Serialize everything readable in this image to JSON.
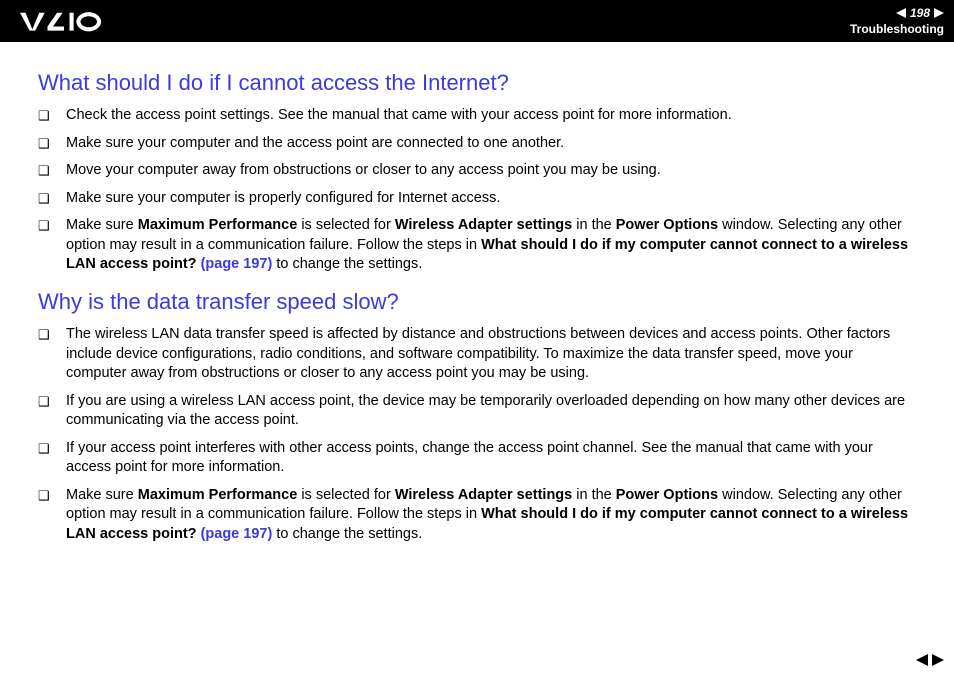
{
  "header": {
    "page_number": "198",
    "section": "Troubleshooting"
  },
  "sections": [
    {
      "heading": "What should I do if I cannot access the Internet?",
      "items": [
        {
          "runs": [
            {
              "t": "Check the access point settings. See the manual that came with your access point for more information."
            }
          ]
        },
        {
          "runs": [
            {
              "t": "Make sure your computer and the access point are connected to one another."
            }
          ]
        },
        {
          "runs": [
            {
              "t": "Move your computer away from obstructions or closer to any access point you may be using."
            }
          ]
        },
        {
          "runs": [
            {
              "t": "Make sure your computer is properly configured for Internet access."
            }
          ]
        },
        {
          "runs": [
            {
              "t": "Make sure "
            },
            {
              "t": "Maximum Performance",
              "b": true
            },
            {
              "t": " is selected for "
            },
            {
              "t": "Wireless Adapter settings",
              "b": true
            },
            {
              "t": " in the "
            },
            {
              "t": "Power Options",
              "b": true
            },
            {
              "t": " window. Selecting any other option may result in a communication failure. Follow the steps in "
            },
            {
              "t": "What should I do if my computer cannot connect to a wireless LAN access point? ",
              "b": true
            },
            {
              "t": "(page 197)",
              "link": true
            },
            {
              "t": " to change the settings."
            }
          ]
        }
      ]
    },
    {
      "heading": "Why is the data transfer speed slow?",
      "items": [
        {
          "runs": [
            {
              "t": "The wireless LAN data transfer speed is affected by distance and obstructions between devices and access points. Other factors include device configurations, radio conditions, and software compatibility. To maximize the data transfer speed, move your computer away from obstructions or closer to any access point you may be using."
            }
          ]
        },
        {
          "runs": [
            {
              "t": "If you are using a wireless LAN access point, the device may be temporarily overloaded depending on how many other devices are communicating via the access point."
            }
          ]
        },
        {
          "runs": [
            {
              "t": "If your access point interferes with other access points, change the access point channel. See the manual that came with your access point for more information."
            }
          ]
        },
        {
          "runs": [
            {
              "t": "Make sure "
            },
            {
              "t": "Maximum Performance",
              "b": true
            },
            {
              "t": " is selected for "
            },
            {
              "t": "Wireless Adapter settings",
              "b": true
            },
            {
              "t": " in the "
            },
            {
              "t": "Power Options",
              "b": true
            },
            {
              "t": " window. Selecting any other option may result in a communication failure. Follow the steps in "
            },
            {
              "t": "What should I do if my computer cannot connect to a wireless LAN access point? ",
              "b": true
            },
            {
              "t": "(page 197)",
              "link": true
            },
            {
              "t": " to change the settings."
            }
          ]
        }
      ]
    }
  ]
}
